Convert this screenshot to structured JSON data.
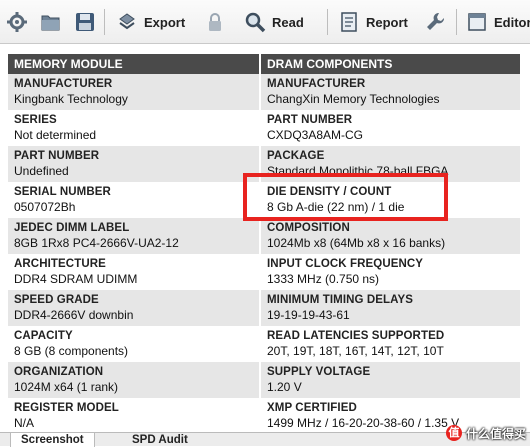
{
  "toolbar": {
    "export_label": "Export",
    "read_label": "Read",
    "report_label": "Report",
    "editor_label": "Editor"
  },
  "headers": {
    "left": "MEMORY MODULE",
    "right": "DRAM COMPONENTS"
  },
  "rows": [
    {
      "left_label": "MANUFACTURER",
      "left_value": "Kingbank Technology",
      "right_label": "MANUFACTURER",
      "right_value": "ChangXin Memory Technologies"
    },
    {
      "left_label": "SERIES",
      "left_value": "Not determined",
      "right_label": "PART NUMBER",
      "right_value": "CXDQ3A8AM-CG"
    },
    {
      "left_label": "PART NUMBER",
      "left_value": "Undefined",
      "right_label": "PACKAGE",
      "right_value": "Standard Monolithic 78-ball FBGA"
    },
    {
      "left_label": "SERIAL NUMBER",
      "left_value": "0507072Bh",
      "right_label": "DIE DENSITY / COUNT",
      "right_value": "8 Gb A-die (22 nm) / 1 die"
    },
    {
      "left_label": "JEDEC DIMM LABEL",
      "left_value": "8GB 1Rx8 PC4-2666V-UA2-12",
      "right_label": "COMPOSITION",
      "right_value": "1024Mb x8 (64Mb x8 x 16 banks)"
    },
    {
      "left_label": "ARCHITECTURE",
      "left_value": "DDR4 SDRAM UDIMM",
      "right_label": "INPUT CLOCK FREQUENCY",
      "right_value": "1333 MHz (0.750 ns)"
    },
    {
      "left_label": "SPEED GRADE",
      "left_value": "DDR4-2666V downbin",
      "right_label": "MINIMUM TIMING DELAYS",
      "right_value": "19-19-19-43-61"
    },
    {
      "left_label": "CAPACITY",
      "left_value": "8 GB (8 components)",
      "right_label": "READ LATENCIES SUPPORTED",
      "right_value": "20T, 19T, 18T, 16T, 14T, 12T, 10T"
    },
    {
      "left_label": "ORGANIZATION",
      "left_value": "1024M x64 (1 rank)",
      "right_label": "SUPPLY VOLTAGE",
      "right_value": "1.20 V"
    },
    {
      "left_label": "REGISTER MODEL",
      "left_value": "N/A",
      "right_label": "XMP CERTIFIED",
      "right_value": "1499 MHz / 16-20-20-38-60 / 1.35 V"
    }
  ],
  "tabs": {
    "screenshot": "Screenshot",
    "spd_audit": "SPD Audit"
  },
  "watermark": {
    "badge": "值",
    "text": "什么值得买"
  },
  "colors": {
    "highlight": "#e8231f",
    "header_bg": "#4a4a4a",
    "shade_bg": "#e6e6e6"
  }
}
